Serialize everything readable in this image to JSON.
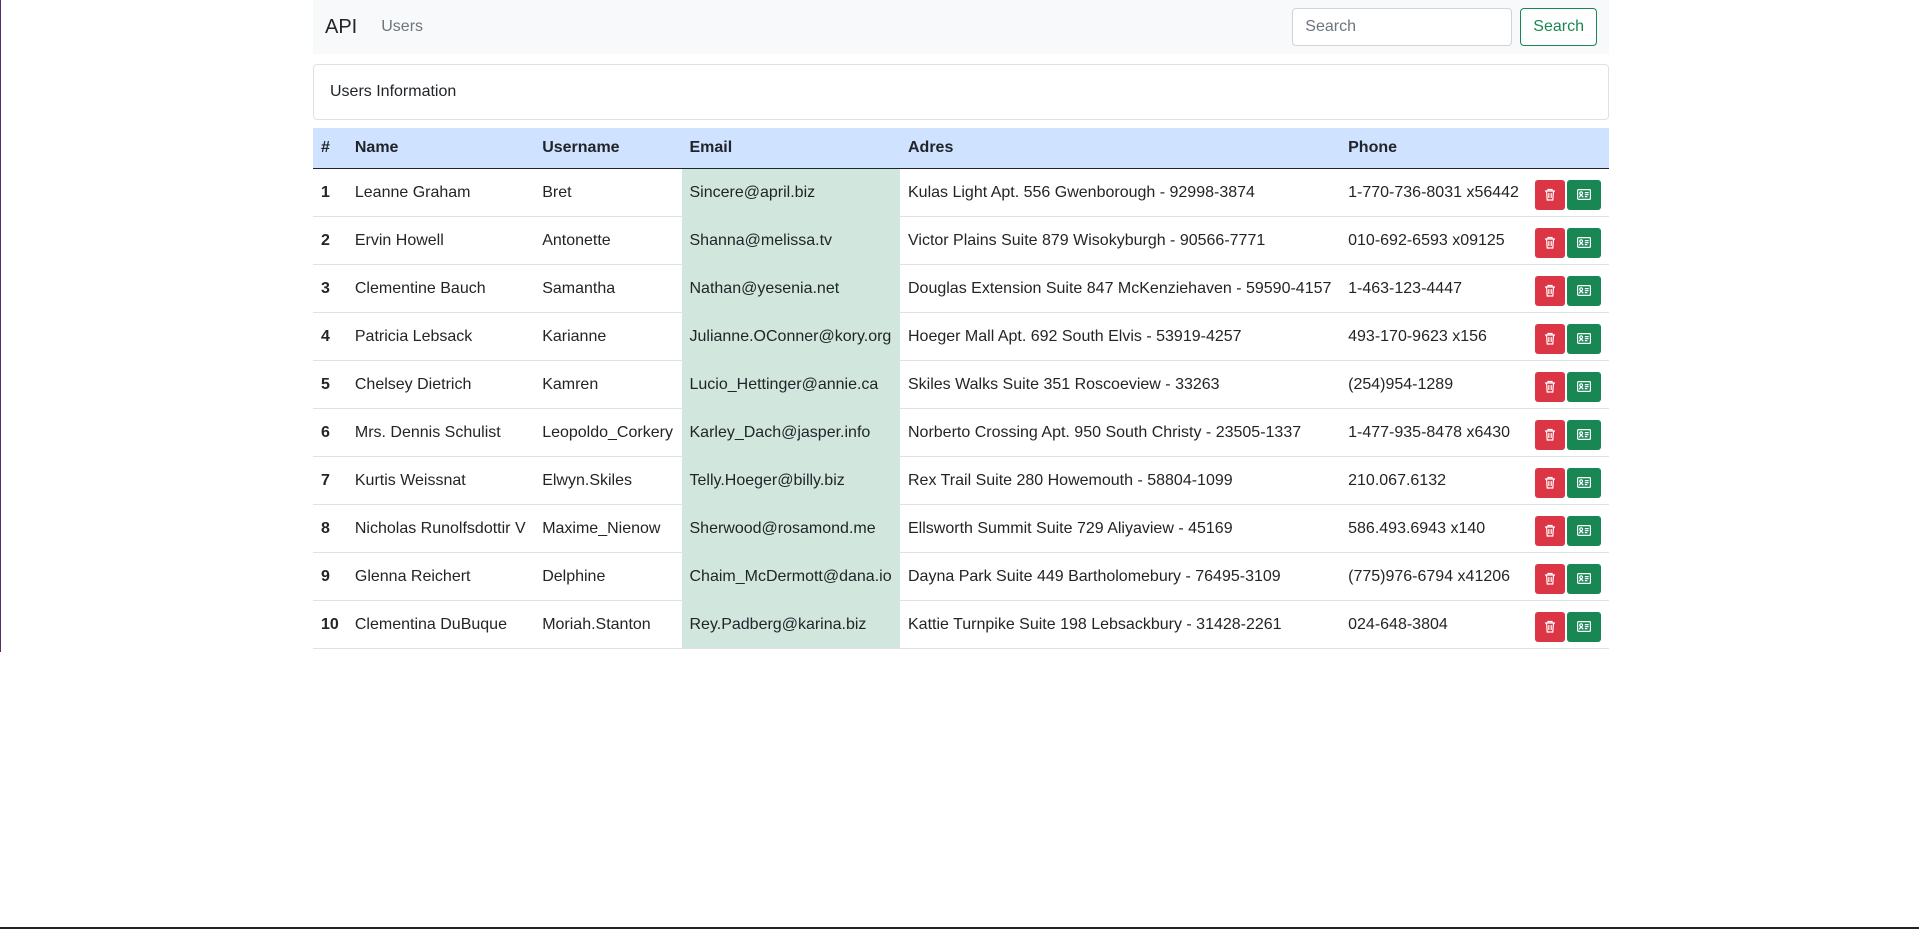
{
  "navbar": {
    "brand": "API",
    "link_users": "Users",
    "search_placeholder": "Search",
    "search_button": "Search"
  },
  "card": {
    "title": "Users Information"
  },
  "table": {
    "headers": {
      "idx": "#",
      "name": "Name",
      "username": "Username",
      "email": "Email",
      "address": "Adres",
      "phone": "Phone"
    },
    "rows": [
      {
        "idx": "1",
        "name": "Leanne Graham",
        "username": "Bret",
        "email": "Sincere@april.biz",
        "address": "Kulas Light Apt. 556 Gwenborough - 92998-3874",
        "phone": "1-770-736-8031 x56442"
      },
      {
        "idx": "2",
        "name": "Ervin Howell",
        "username": "Antonette",
        "email": "Shanna@melissa.tv",
        "address": "Victor Plains Suite 879 Wisokyburgh - 90566-7771",
        "phone": "010-692-6593 x09125"
      },
      {
        "idx": "3",
        "name": "Clementine Bauch",
        "username": "Samantha",
        "email": "Nathan@yesenia.net",
        "address": "Douglas Extension Suite 847 McKenziehaven - 59590-4157",
        "phone": "1-463-123-4447"
      },
      {
        "idx": "4",
        "name": "Patricia Lebsack",
        "username": "Karianne",
        "email": "Julianne.OConner@kory.org",
        "address": "Hoeger Mall Apt. 692 South Elvis - 53919-4257",
        "phone": "493-170-9623 x156"
      },
      {
        "idx": "5",
        "name": "Chelsey Dietrich",
        "username": "Kamren",
        "email": "Lucio_Hettinger@annie.ca",
        "address": "Skiles Walks Suite 351 Roscoeview - 33263",
        "phone": "(254)954-1289"
      },
      {
        "idx": "6",
        "name": "Mrs. Dennis Schulist",
        "username": "Leopoldo_Corkery",
        "email": "Karley_Dach@jasper.info",
        "address": "Norberto Crossing Apt. 950 South Christy - 23505-1337",
        "phone": "1-477-935-8478 x6430"
      },
      {
        "idx": "7",
        "name": "Kurtis Weissnat",
        "username": "Elwyn.Skiles",
        "email": "Telly.Hoeger@billy.biz",
        "address": "Rex Trail Suite 280 Howemouth - 58804-1099",
        "phone": "210.067.6132"
      },
      {
        "idx": "8",
        "name": "Nicholas Runolfsdottir V",
        "username": "Maxime_Nienow",
        "email": "Sherwood@rosamond.me",
        "address": "Ellsworth Summit Suite 729 Aliyaview - 45169",
        "phone": "586.493.6943 x140"
      },
      {
        "idx": "9",
        "name": "Glenna Reichert",
        "username": "Delphine",
        "email": "Chaim_McDermott@dana.io",
        "address": "Dayna Park Suite 449 Bartholomebury - 76495-3109",
        "phone": "(775)976-6794 x41206"
      },
      {
        "idx": "10",
        "name": "Clementina DuBuque",
        "username": "Moriah.Stanton",
        "email": "Rey.Padberg@karina.biz",
        "address": "Kattie Turnpike Suite 198 Lebsackbury - 31428-2261",
        "phone": "024-648-3804"
      }
    ]
  },
  "icons": {
    "delete": "trash-icon",
    "details": "person-vcard-icon"
  },
  "colors": {
    "header_bg": "#cfe2ff",
    "email_col_bg": "#d1e7dd",
    "danger": "#dc3545",
    "success": "#198754"
  }
}
